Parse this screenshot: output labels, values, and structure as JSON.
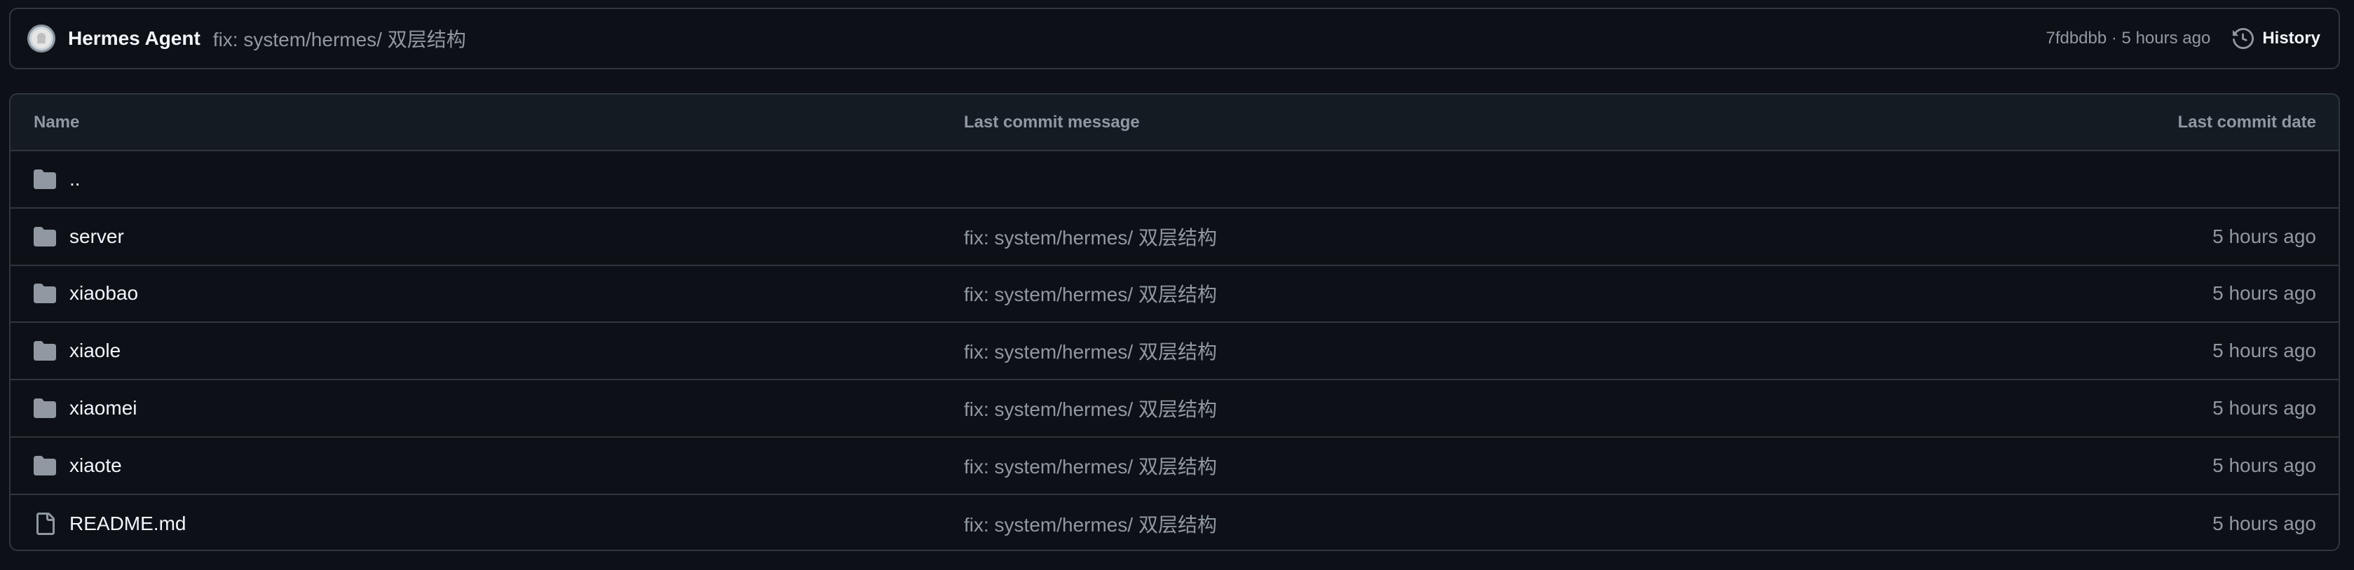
{
  "commit_bar": {
    "author": "Hermes Agent",
    "message": "fix: system/hermes/ 双层结构",
    "meta": "7fdbdbb · 5 hours ago",
    "history_label": "History",
    "avatar_icon": "avatar-icon",
    "history_icon": "history-icon"
  },
  "table": {
    "headers": {
      "name": "Name",
      "message": "Last commit message",
      "date": "Last commit date"
    },
    "rows": [
      {
        "name": "..",
        "icon": "folder-icon",
        "message": "",
        "date": ""
      },
      {
        "name": "server",
        "icon": "folder-icon",
        "message": "fix: system/hermes/ 双层结构",
        "date": "5 hours ago"
      },
      {
        "name": "xiaobao",
        "icon": "folder-icon",
        "message": "fix: system/hermes/ 双层结构",
        "date": "5 hours ago"
      },
      {
        "name": "xiaole",
        "icon": "folder-icon",
        "message": "fix: system/hermes/ 双层结构",
        "date": "5 hours ago"
      },
      {
        "name": "xiaomei",
        "icon": "folder-icon",
        "message": "fix: system/hermes/ 双层结构",
        "date": "5 hours ago"
      },
      {
        "name": "xiaote",
        "icon": "folder-icon",
        "message": "fix: system/hermes/ 双层结构",
        "date": "5 hours ago"
      },
      {
        "name": "README.md",
        "icon": "file-icon",
        "message": "fix: system/hermes/ 双层结构",
        "date": "5 hours ago"
      }
    ]
  },
  "colors": {
    "background": "#0d1117",
    "header_background": "#151b23",
    "border": "#30363d",
    "text_primary": "#f0f6fc",
    "text_muted": "#9198a1",
    "icon": "#9198a1"
  }
}
